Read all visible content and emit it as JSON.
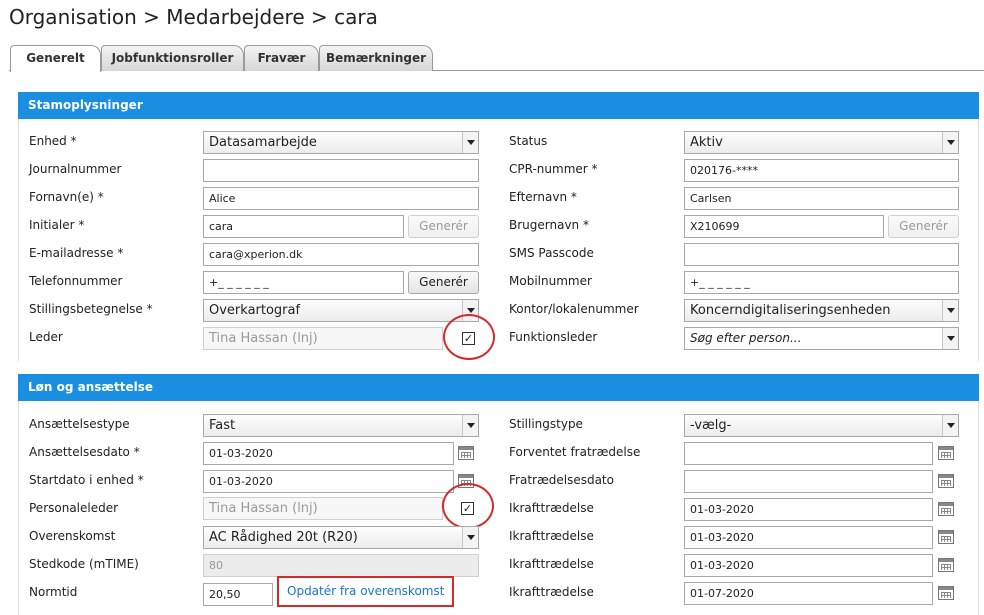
{
  "breadcrumb": "Organisation > Medarbejdere > cara",
  "tabs": [
    "Generelt",
    "Jobfunktionsroller",
    "Fravær",
    "Bemærkninger"
  ],
  "sections": {
    "stamdata": "Stamoplysninger",
    "loen": "Løn og ansættelse"
  },
  "stam": {
    "enhed": {
      "label": "Enhed *",
      "value": "Datasamarbejde"
    },
    "journal": {
      "label": "Journalnummer",
      "value": ""
    },
    "fornavn": {
      "label": "Fornavn(e) *",
      "value": "Alice"
    },
    "initialer": {
      "label": "Initialer *",
      "value": "cara",
      "button": "Generér"
    },
    "email": {
      "label": "E-mailadresse *",
      "value": "cara@xperion.dk"
    },
    "telefon": {
      "label": "Telefonnummer",
      "value": "+_ _ _ _ _ _",
      "button": "Generér"
    },
    "stilling": {
      "label": "Stillingsbetegnelse *",
      "value": "Overkartograf"
    },
    "leder": {
      "label": "Leder",
      "value": "Tina Hassan (lnj)"
    },
    "status": {
      "label": "Status",
      "value": "Aktiv"
    },
    "cpr": {
      "label": "CPR-nummer *",
      "value": "020176-****"
    },
    "efternavn": {
      "label": "Efternavn *",
      "value": "Carlsen"
    },
    "brugernavn": {
      "label": "Brugernavn *",
      "value": "X210699",
      "button": "Generér"
    },
    "sms": {
      "label": "SMS Passcode",
      "value": ""
    },
    "mobil": {
      "label": "Mobilnummer",
      "value": "+_ _ _ _ _ _"
    },
    "kontor": {
      "label": "Kontor/lokalenummer",
      "value": "Koncerndigitaliseringsenheden"
    },
    "funktionsleder": {
      "label": "Funktionsleder",
      "placeholder": "Søg efter person..."
    }
  },
  "loen": {
    "type": {
      "label": "Ansættelsestype",
      "value": "Fast"
    },
    "ansdato": {
      "label": "Ansættelsesdato *",
      "value": "01-03-2020"
    },
    "startdato": {
      "label": "Startdato i enhed *",
      "value": "01-03-2020"
    },
    "personaleleder": {
      "label": "Personaleleder",
      "value": "Tina Hassan (lnj)"
    },
    "overenskomst": {
      "label": "Overenskomst",
      "value": "AC Rådighed 20t (R20)"
    },
    "stedkode": {
      "label": "Stedkode (mTIME)",
      "value": "80"
    },
    "normtid": {
      "label": "Normtid",
      "value": "20,50",
      "link": "Opdatér fra overenskomst"
    },
    "stillingstype": {
      "label": "Stillingstype",
      "value": "-vælg-"
    },
    "forventet": {
      "label": "Forventet fratrædelse",
      "value": ""
    },
    "fratraedelse": {
      "label": "Fratrædelsesdato",
      "value": ""
    },
    "ikraft": [
      {
        "label": "Ikrafttrædelse",
        "value": "01-03-2020"
      },
      {
        "label": "Ikrafttrædelse",
        "value": "01-03-2020"
      },
      {
        "label": "Ikrafttrædelse",
        "value": "01-03-2020"
      },
      {
        "label": "Ikrafttrædelse",
        "value": "01-07-2020"
      }
    ]
  }
}
